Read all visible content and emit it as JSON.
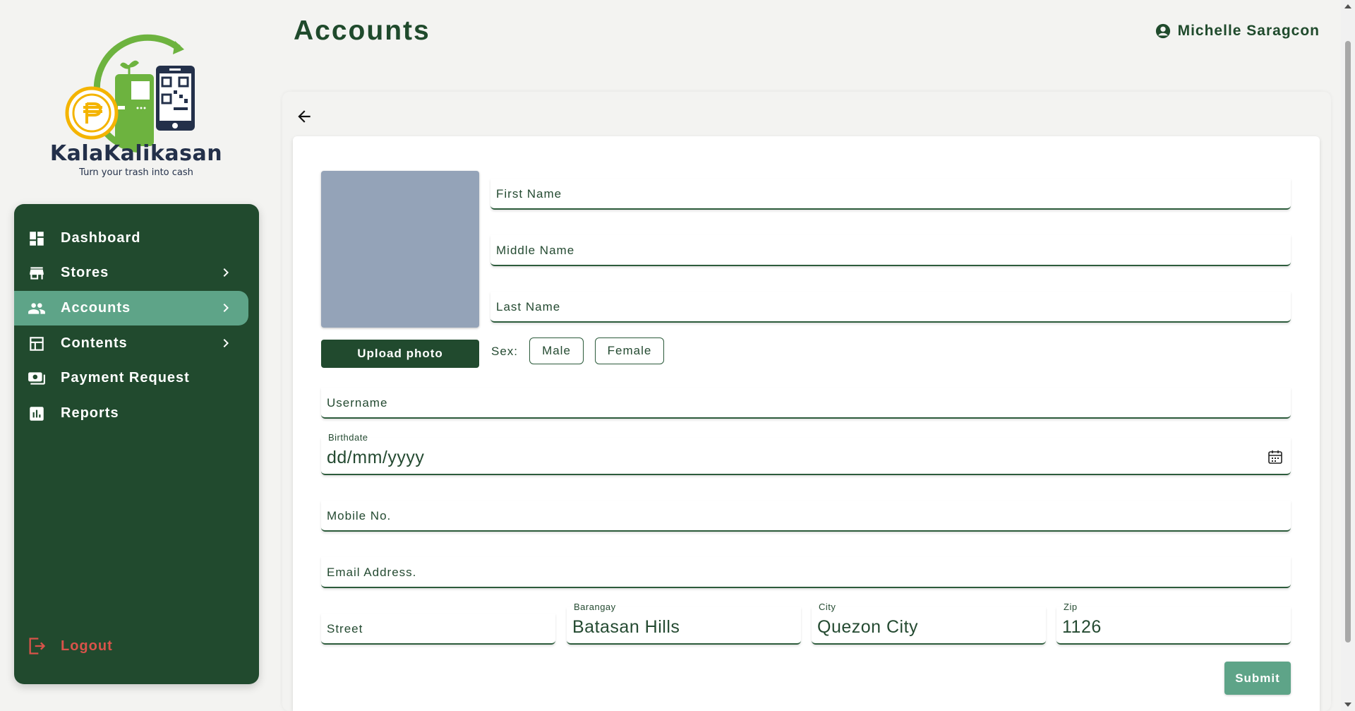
{
  "brand": {
    "name": "KalaKalikasan",
    "tagline": "Turn your trash into cash"
  },
  "sidebar": {
    "items": [
      {
        "label": "Dashboard",
        "icon": "dashboard-icon",
        "has_chevron": false,
        "active": false
      },
      {
        "label": "Stores",
        "icon": "store-icon",
        "has_chevron": true,
        "active": false
      },
      {
        "label": "Accounts",
        "icon": "users-icon",
        "has_chevron": true,
        "active": true
      },
      {
        "label": "Contents",
        "icon": "table-icon",
        "has_chevron": true,
        "active": false
      },
      {
        "label": "Payment Request",
        "icon": "payment-icon",
        "has_chevron": false,
        "active": false
      },
      {
        "label": "Reports",
        "icon": "chart-icon",
        "has_chevron": false,
        "active": false
      }
    ],
    "logout_label": "Logout"
  },
  "header": {
    "title": "Accounts",
    "user_name": "Michelle Saragcon"
  },
  "form": {
    "upload_label": "Upload photo",
    "first_name": "First Name",
    "middle_name": "Middle Name",
    "last_name": "Last Name",
    "sex_label": "Sex:",
    "sex_options": [
      "Male",
      "Female"
    ],
    "username": "Username",
    "birthdate_label": "Birthdate",
    "birthdate_value": "dd/mm/yyyy",
    "mobile": "Mobile No.",
    "email": "Email Address.",
    "street": "Street",
    "barangay_label": "Barangay",
    "barangay_value": "Batasan Hills",
    "city_label": "City",
    "city_value": "Quezon City",
    "zip_label": "Zip",
    "zip_value": "1126",
    "submit_label": "Submit"
  },
  "colors": {
    "sidebar": "#214a2e",
    "active": "#5ea488",
    "logout": "#d9534a",
    "photo": "#94a3b8"
  }
}
